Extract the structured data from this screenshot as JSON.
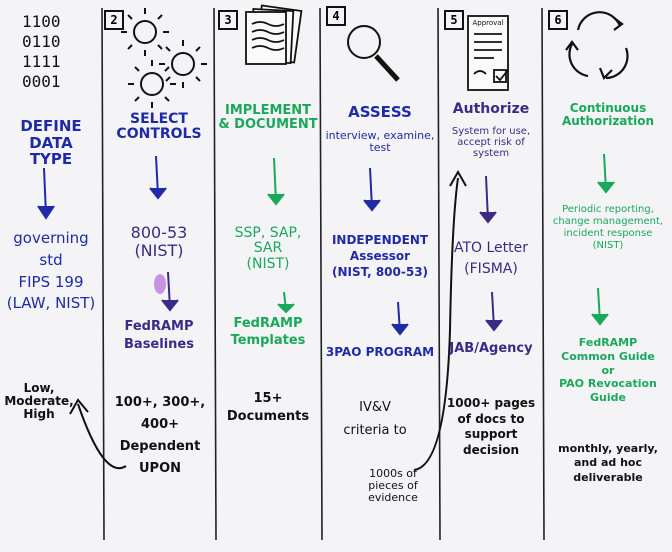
{
  "colors": {
    "blue": "#1f2aa6",
    "green": "#1aa85a",
    "purple": "#3b2a86",
    "black": "#111111",
    "highlight": "#b86ad9"
  },
  "columns": [
    {
      "number": "",
      "binary": "1100\n0110\n1111\n0001",
      "title": "DEFINE DATA\nTYPE",
      "middle": "governing std\nFIPS 199\n(LAW, NIST)",
      "bottom": "Low,\nModerate,\nHigh"
    },
    {
      "number": "2",
      "title": "SELECT\nCONTROLS",
      "middle": "800-53\n(NIST)",
      "middle2": "FedRAMP\nBaselines",
      "bottom": "100+, 300+, 400+\nDependent\nUPON"
    },
    {
      "number": "3",
      "title": "IMPLEMENT\n& DOCUMENT",
      "middle": "SSP, SAP,\nSAR\n(NIST)",
      "middle2": "FedRAMP\nTemplates",
      "bottom": "15+\nDocuments"
    },
    {
      "number": "4",
      "title": "ASSESS",
      "subtitle": "interview, examine,\ntest",
      "middle": "INDEPENDENT\nAssessor\n(NIST, 800-53)",
      "middle2": "3PAO PROGRAM",
      "bottom": "IV&V\ncriteria to",
      "bottom2": "1000s of\npieces of\nevidence"
    },
    {
      "number": "5",
      "title": "Authorize",
      "subtitle": "System for use,\naccept risk of\nsystem",
      "middle": "ATO Letter\n(FISMA)",
      "middle2": "JAB/Agency",
      "bottom": "1000+ pages\nof docs to\nsupport\ndecision",
      "doc_label": "Approval"
    },
    {
      "number": "6",
      "title": "Continuous\nAuthorization",
      "middle": "Periodic reporting,\nchange management,\nincident response\n(NIST)",
      "middle2": "FedRAMP\nCommon Guide\nor\nPAO Revocation\nGuide",
      "bottom": "monthly, yearly,\nand ad hoc\ndeliverable"
    }
  ]
}
